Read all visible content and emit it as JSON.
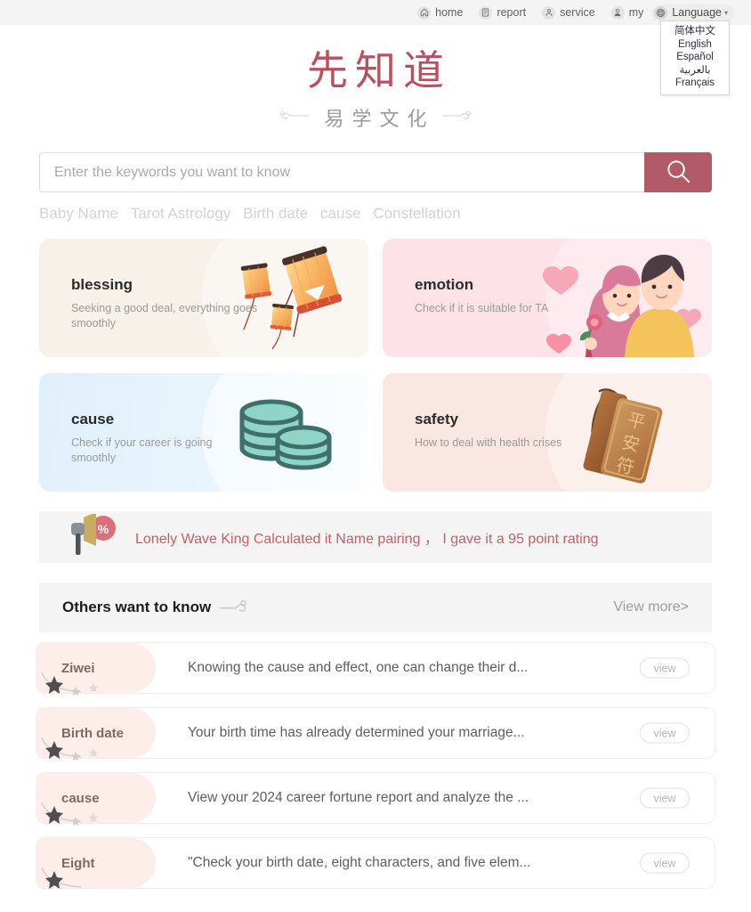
{
  "topnav": {
    "items": [
      {
        "label": "home",
        "icon": "home-icon"
      },
      {
        "label": "report",
        "icon": "report-icon"
      },
      {
        "label": "service",
        "icon": "service-icon"
      },
      {
        "label": "my",
        "icon": "user-icon"
      }
    ],
    "language": {
      "label": "Language",
      "icon": "globe-icon",
      "caret": "▾"
    },
    "language_menu": [
      "简体中文",
      "English",
      "Español",
      "بالعربية",
      "Français"
    ]
  },
  "logo": {
    "main": "先知道",
    "sub": "易学文化"
  },
  "search": {
    "placeholder": "Enter the keywords you want to know",
    "value": "",
    "button_icon": "search-icon",
    "button_color": "#b35a69"
  },
  "hot_tags": [
    "Baby Name",
    "Tarot Astrology",
    "Birth date",
    "cause",
    "Constellation"
  ],
  "cards": [
    {
      "title": "blessing",
      "subtitle": "Seeking a good deal, everything goes smoothly",
      "art": "lanterns-icon",
      "bg": "#f7f1e9"
    },
    {
      "title": "emotion",
      "subtitle": "Check if it is suitable for TA",
      "art": "couple-icon",
      "bg": "#fde3e8"
    },
    {
      "title": "cause",
      "subtitle": "Check if your career is going smoothly",
      "art": "coins-icon",
      "bg": "#e2f1fb"
    },
    {
      "title": "safety",
      "subtitle": "How to deal with health crises",
      "art": "amulet-icon",
      "bg": "#fae7e2"
    }
  ],
  "announcement": {
    "icon": "megaphone-icon",
    "badge": "%",
    "message": "Lonely Wave King Calculated it  Name pairing ，  I gave it a 95 point rating",
    "color": "#c1616d"
  },
  "section": {
    "title": "Others want to know",
    "decoration": "cloud-icon",
    "more_label": "View more>"
  },
  "questions": [
    {
      "tag": "Ziwei",
      "text": "Knowing the cause and effect, one can change their d...",
      "action": "view"
    },
    {
      "tag": "Birth date",
      "text": "Your birth time has already determined your marriage...",
      "action": "view"
    },
    {
      "tag": "cause",
      "text": "View your 2024 career fortune report and analyze the ...",
      "action": "view"
    },
    {
      "tag": "Eight",
      "text": "\"Check your birth date, eight characters, and five elem...",
      "action": "view"
    }
  ]
}
